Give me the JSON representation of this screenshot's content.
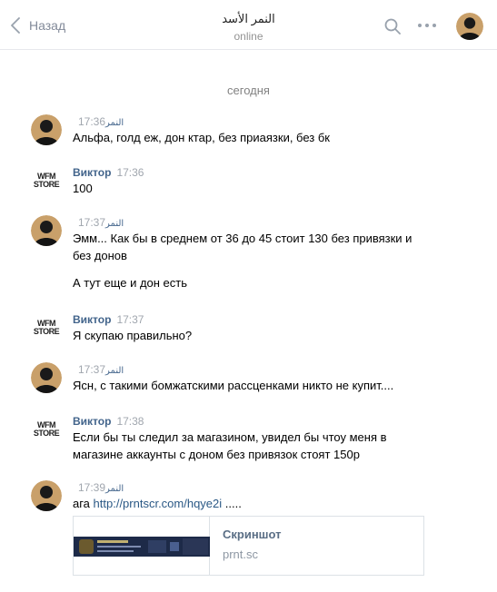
{
  "header": {
    "back_label": "Назад",
    "title": "النمر الأسد",
    "status": "online"
  },
  "date_separator": "сегодня",
  "messages": [
    {
      "author": "النمر",
      "time": "17:36",
      "lines": [
        "Альфа, голд еж, дон ктар, без приаязки, без бк"
      ]
    },
    {
      "author": "Виктор",
      "time": "17:36",
      "lines": [
        "100"
      ]
    },
    {
      "author": "النمر",
      "time": "17:37",
      "lines": [
        "Эмм... Как бы в среднем от 36 до 45 стоит 130 без привязки и",
        "без донов",
        "А тут еще и дон есть"
      ]
    },
    {
      "author": "Виктор",
      "time": "17:37",
      "lines": [
        "Я скупаю правильно?"
      ]
    },
    {
      "author": "النمر",
      "time": "17:37",
      "lines": [
        "Ясн, с такими бомжатскими рассценками никто не купит...."
      ]
    },
    {
      "author": "Виктор",
      "time": "17:38",
      "lines": [
        "Если бы ты следил за магазином, увидел бы чтоу меня в",
        "магазине аккаунты с доном без привязок стоят 150р"
      ]
    },
    {
      "author": "النمر",
      "time": "17:39",
      "text_prefix": "ага ",
      "link_text": "http://prntscr.com/hqye2i",
      "text_suffix": " ....."
    }
  ],
  "store_logo": {
    "line1": "WFM",
    "line2": "STORE"
  },
  "link_card": {
    "title": "Скриншот",
    "domain": "prnt.sc"
  },
  "colors": {
    "author": "#42648b",
    "link": "#2a5885",
    "muted": "#828282"
  }
}
